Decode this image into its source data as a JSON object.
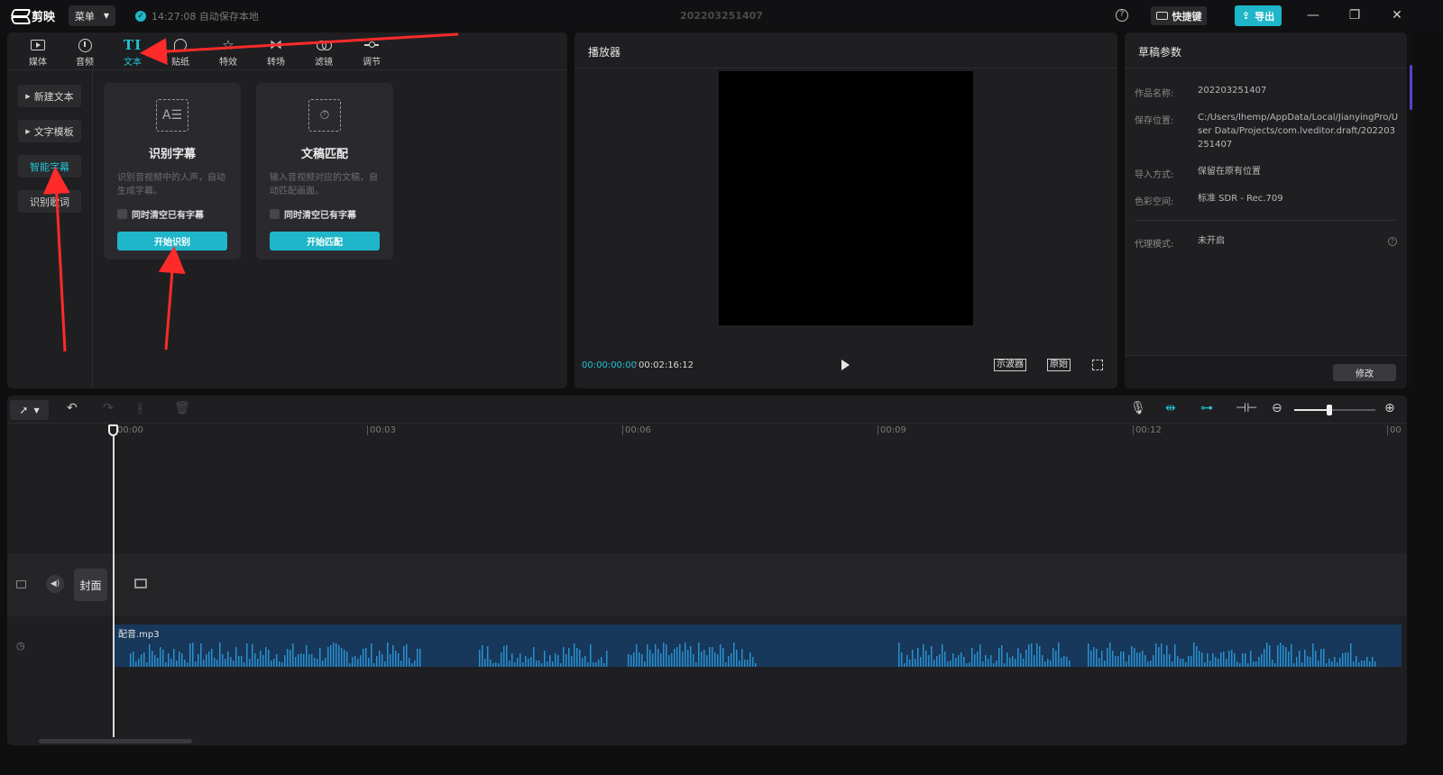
{
  "app": {
    "name": "剪映",
    "menu_label": "菜单",
    "autosave_status": "14:27:08 自动保存本地",
    "project_title": "202203251407",
    "shortcut_label": "快捷键",
    "export_label": "导出",
    "accent_color": "#1fb6c9"
  },
  "toolbar": {
    "tabs": [
      {
        "label": "媒体",
        "icon": "media-icon"
      },
      {
        "label": "音频",
        "icon": "audio-icon"
      },
      {
        "label": "文本",
        "icon": "text-icon",
        "active": true
      },
      {
        "label": "贴纸",
        "icon": "sticker-icon"
      },
      {
        "label": "特效",
        "icon": "effect-icon"
      },
      {
        "label": "转场",
        "icon": "transition-icon"
      },
      {
        "label": "滤镜",
        "icon": "filter-icon"
      },
      {
        "label": "调节",
        "icon": "adjust-icon"
      }
    ]
  },
  "text_nav": {
    "items": [
      {
        "label": "新建文本",
        "expandable": true
      },
      {
        "label": "文字模板",
        "expandable": true
      },
      {
        "label": "智能字幕",
        "active": true
      },
      {
        "label": "识别歌词"
      }
    ]
  },
  "cards": [
    {
      "title": "识别字幕",
      "description": "识别音视频中的人声，自动生成字幕。",
      "checkbox_label": "同时清空已有字幕",
      "button_label": "开始识别",
      "icon": "subtitle-recognize-icon"
    },
    {
      "title": "文稿匹配",
      "description": "输入音视频对应的文稿，自动匹配画面。",
      "checkbox_label": "同时清空已有字幕",
      "button_label": "开始匹配",
      "icon": "script-match-icon"
    }
  ],
  "player": {
    "title": "播放器",
    "current_time": "00:00:00:00",
    "separator": "/",
    "total_time": "00:02:16:12",
    "scope_label": "示波器",
    "original_label": "原始"
  },
  "draft": {
    "title": "草稿参数",
    "fields": [
      {
        "label": "作品名称:",
        "value": "202203251407"
      },
      {
        "label": "保存位置:",
        "value": "C:/Users/lhemp/AppData/Local/JianyingPro/User Data/Projects/com.lveditor.draft/202203251407"
      },
      {
        "label": "导入方式:",
        "value": "保留在原有位置"
      },
      {
        "label": "色彩空间:",
        "value": "标准 SDR - Rec.709"
      },
      {
        "label": "代理模式:",
        "value": "未开启"
      }
    ],
    "modify_label": "修改"
  },
  "timeline": {
    "ruler": [
      "00:00",
      "00:03",
      "00:06",
      "00:09",
      "00:12",
      "00"
    ],
    "cover_label": "封面",
    "audio_clip_name": "配音.mp3",
    "zoom_level": 0.42
  }
}
